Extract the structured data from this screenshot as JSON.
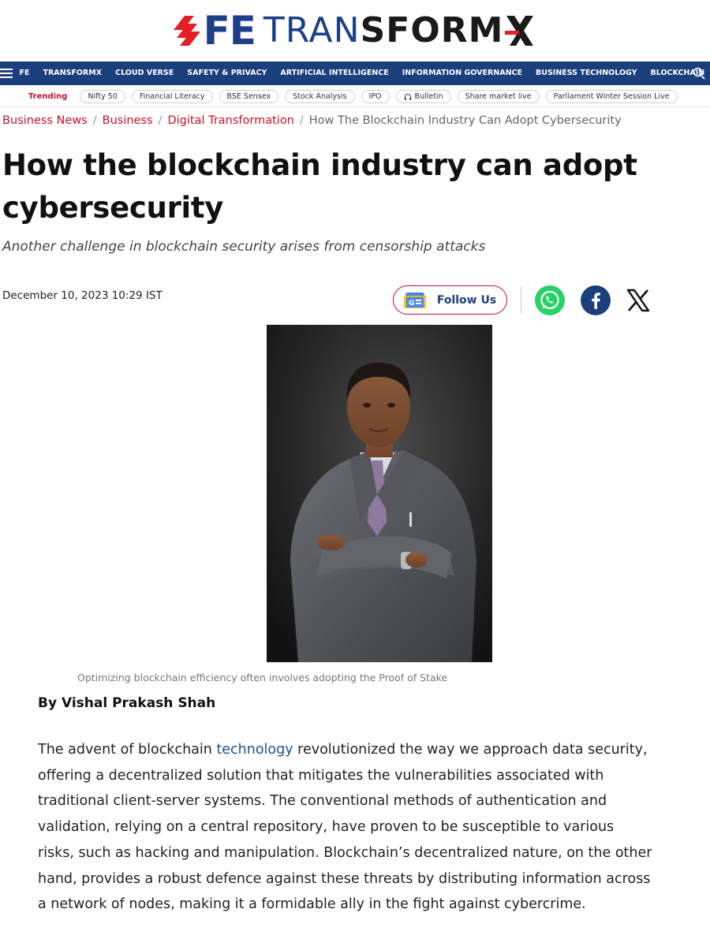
{
  "header": {
    "logo_fe": "FE",
    "logo_transform_light": "TRAN",
    "logo_transform_bold": "SFORM",
    "brand_colors": {
      "navy": "#1d3f8a",
      "red": "#e31e24"
    }
  },
  "nav": {
    "items": [
      "FE",
      "TRANSFORMX",
      "CLOUD VERSE",
      "SAFETY & PRIVACY",
      "ARTIFICIAL INTELLIGENCE",
      "INFORMATION GOVERNANCE",
      "BUSINESS TECHNOLOGY",
      "BLOCKCHAIN"
    ],
    "menu_icon": "hamburger-icon",
    "search_icon": "search-icon",
    "background": "#1b3f7c"
  },
  "trending": {
    "label": "Trending",
    "chips": [
      "Nifty 50",
      "Financial Literacy",
      "BSE Sensex",
      "Stock Analysis",
      "IPO",
      "Bulletin",
      "Share market live",
      "Parliament Winter Session Live"
    ]
  },
  "breadcrumb": {
    "links": [
      "Business News",
      "Business",
      "Digital Transformation"
    ],
    "separator": "/",
    "current": "How The Blockchain Industry Can Adopt Cybersecurity"
  },
  "article": {
    "title": "How the blockchain industry can adopt cybersecurity",
    "subtitle": "Another challenge in blockchain security arises from censorship attacks",
    "date": "December 10, 2023 10:29 IST",
    "follow_label": "Follow Us",
    "caption": "Optimizing blockchain efficiency often involves adopting the Proof of Stake",
    "byline": "By Vishal Prakash Shah",
    "body_before_link": "The advent of blockchain ",
    "body_link": "technology",
    "body_after_link": " revolutionized the way we approach data security, offering a decentralized solution that mitigates the vulnerabilities associated with traditional client-server systems. The conventional methods of authentication and validation, relying on a central repository, have proven to be susceptible to various risks, such as hacking and manipulation. Blockchain’s decentralized nature, on the other hand, provides a robust defence against these threats by distributing information across a network of nodes, making it a formidable ally in the fight against cybercrime."
  }
}
